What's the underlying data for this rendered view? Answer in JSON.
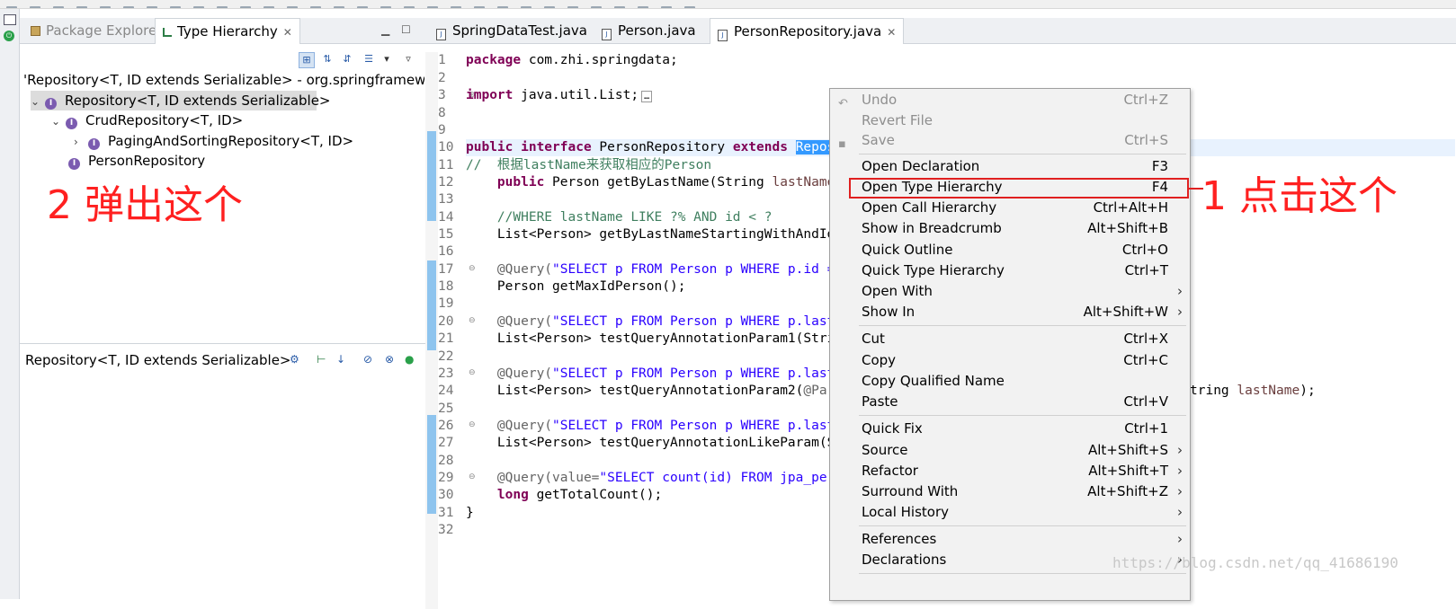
{
  "left_view": {
    "tabs": [
      {
        "label": "Package Explorer"
      },
      {
        "label": "Type Hierarchy"
      }
    ],
    "qualified_title": "'Repository<T, ID extends Serializable> - org.springframework.",
    "tree": [
      {
        "label": "Repository<T, ID extends Serializable>"
      },
      {
        "label": "CrudRepository<T, ID>"
      },
      {
        "label": "PagingAndSortingRepository<T, ID>"
      },
      {
        "label": "PersonRepository"
      }
    ],
    "annotation": "2 弹出这个",
    "member_title": "Repository<T, ID extends Serializable>"
  },
  "editor": {
    "tabs": [
      {
        "label": "SpringDataTest.java"
      },
      {
        "label": "Person.java"
      },
      {
        "label": "PersonRepository.java"
      }
    ],
    "line_numbers": [
      "1",
      "2",
      "3",
      "8",
      "9",
      "10",
      "11",
      "12",
      "13",
      "14",
      "15",
      "16",
      "17",
      "18",
      "19",
      "20",
      "21",
      "22",
      "23",
      "24",
      "25",
      "26",
      "27",
      "28",
      "29",
      "30",
      "31",
      "32"
    ],
    "lines": {
      "l1_kw": "package",
      "l1_rest": " com.zhi.springdata;",
      "l3_kw": "import",
      "l3_rest": " java.util.List;",
      "l10_kw1": "public",
      "l10_kw2": " interface",
      "l10_name": " PersonRepository ",
      "l10_kw3": "extends",
      "l10_sel": "Repos",
      "l11_cmt": "//  根据lastName来获取相应的Person",
      "l12_kw": "    public",
      "l12_rest": " Person getByLastName(String ",
      "l12_par": "lastName",
      "l14_cmt": "    //WHERE lastName LIKE ?% AND id < ?",
      "l15": "    List<Person> getByLastNameStartingWithAndId",
      "l17_ann": "    @Query(",
      "l17_str": "\"SELECT p FROM Person p WHERE p.id =",
      "l18": "    Person getMaxIdPerson();",
      "l20_ann": "    @Query(",
      "l20_str": "\"SELECT p FROM Person p WHERE p.last",
      "l21": "    List<Person> testQueryAnnotationParam1(Stri",
      "l23_ann": "    @Query(",
      "l23_str": "\"SELECT p FROM Person p WHERE p.last",
      "l24_a": "    List<Person> testQueryAnnotationParam2(",
      "l24_b": "@Par",
      "l24_tail": "tring ",
      "l24_par": "lastName",
      "l24_end": ");",
      "l26_ann": "    @Query(",
      "l26_str": "\"SELECT p FROM Person p WHERE p.last",
      "l27": "    List<Person> testQueryAnnotationLikeParam(S",
      "l29_ann": "    @Query(value=",
      "l29_str": "\"SELECT count(id) FROM jpa_per",
      "l30_kw": "    long",
      "l30_rest": " getTotalCount();",
      "l31": "}"
    }
  },
  "context_menu": {
    "items": [
      {
        "label": "Undo",
        "shortcut": "Ctrl+Z"
      },
      {
        "label": "Revert File",
        "shortcut": ""
      },
      {
        "label": "Save",
        "shortcut": "Ctrl+S"
      },
      {
        "label": "Open Declaration",
        "shortcut": "F3"
      },
      {
        "label": "Open Type Hierarchy",
        "shortcut": "F4"
      },
      {
        "label": "Open Call Hierarchy",
        "shortcut": "Ctrl+Alt+H"
      },
      {
        "label": "Show in Breadcrumb",
        "shortcut": "Alt+Shift+B"
      },
      {
        "label": "Quick Outline",
        "shortcut": "Ctrl+O"
      },
      {
        "label": "Quick Type Hierarchy",
        "shortcut": "Ctrl+T"
      },
      {
        "label": "Open With",
        "shortcut": ""
      },
      {
        "label": "Show In",
        "shortcut": "Alt+Shift+W"
      },
      {
        "label": "Cut",
        "shortcut": "Ctrl+X"
      },
      {
        "label": "Copy",
        "shortcut": "Ctrl+C"
      },
      {
        "label": "Copy Qualified Name",
        "shortcut": ""
      },
      {
        "label": "Paste",
        "shortcut": "Ctrl+V"
      },
      {
        "label": "Quick Fix",
        "shortcut": "Ctrl+1"
      },
      {
        "label": "Source",
        "shortcut": "Alt+Shift+S"
      },
      {
        "label": "Refactor",
        "shortcut": "Alt+Shift+T"
      },
      {
        "label": "Surround With",
        "shortcut": "Alt+Shift+Z"
      },
      {
        "label": "Local History",
        "shortcut": ""
      },
      {
        "label": "References",
        "shortcut": ""
      },
      {
        "label": "Declarations",
        "shortcut": ""
      }
    ]
  },
  "annotation_right": "1 点击这个",
  "watermark": "https://blog.csdn.net/qq_41686190",
  "colors": {
    "annotation": "#ff2020",
    "keyword": "#7f0055",
    "string": "#2a00ff",
    "comment": "#3f7f5f",
    "selection": "#3399ff"
  }
}
